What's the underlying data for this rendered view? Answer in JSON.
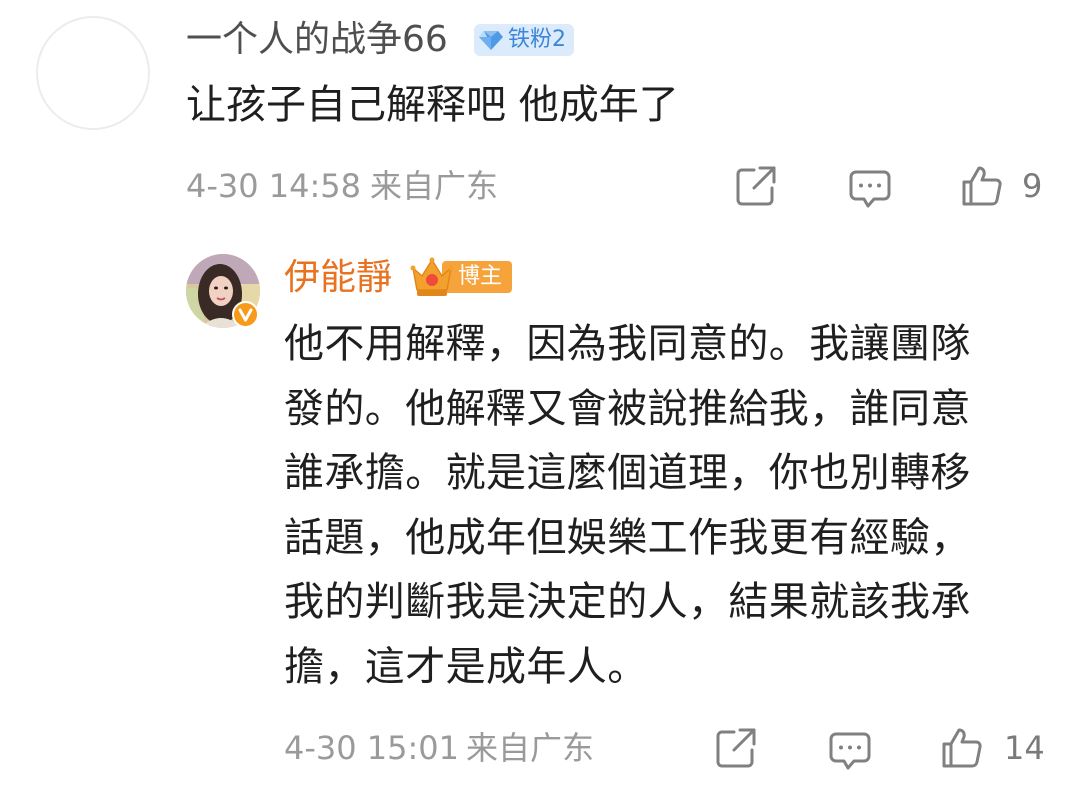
{
  "comment": {
    "username": "一个人的战争66",
    "badge": {
      "icon": "diamond-icon",
      "label": "铁粉2",
      "color": "#3b86d8"
    },
    "text": "让孩子自己解释吧  他成年了",
    "time": "4-30 14:58",
    "location": "来自广东",
    "likes": "9",
    "actions": [
      "share-icon",
      "comment-icon",
      "like-icon"
    ]
  },
  "reply": {
    "username": "伊能靜",
    "username_color": "#e8721f",
    "badge": {
      "icon": "crown-icon",
      "label": "博主",
      "color": "#f6a33c"
    },
    "verified": "verified-v-icon",
    "text": "他不用解釋，因為我同意的。我讓團隊發的。他解釋又會被說推給我，誰同意誰承擔。就是這麼個道理，你也別轉移話題，他成年但娛樂工作我更有經驗，我的判斷我是決定的人，結果就該我承擔，這才是成年人。",
    "time": "4-30 15:01",
    "location": "来自广东",
    "likes": "14",
    "actions": [
      "share-icon",
      "comment-icon",
      "like-icon"
    ]
  }
}
